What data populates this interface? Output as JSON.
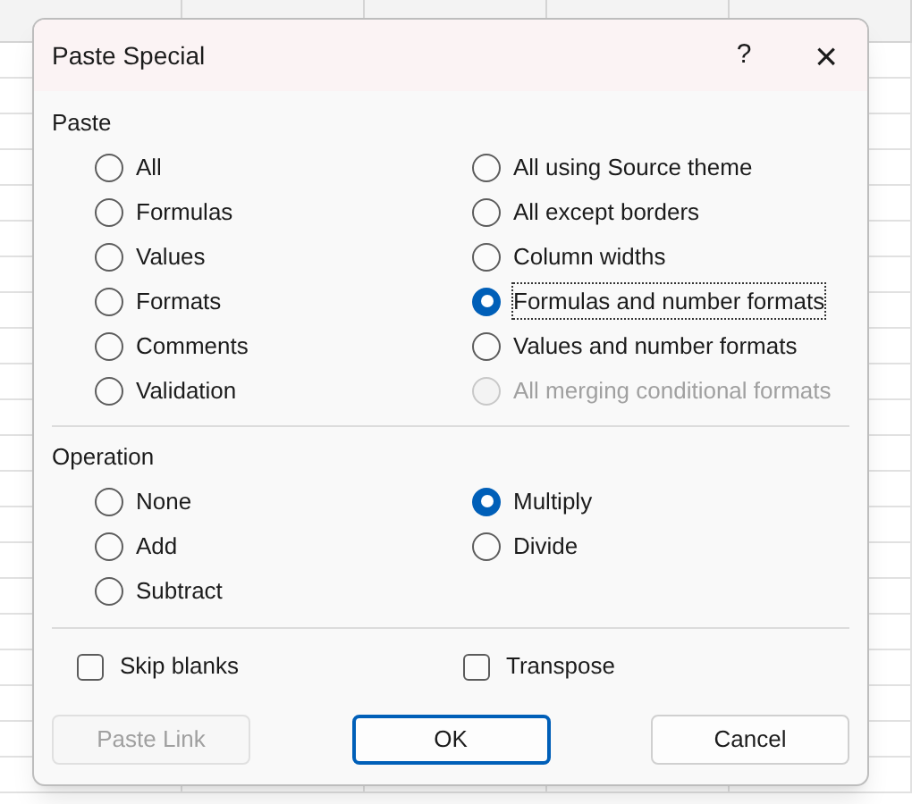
{
  "window": {
    "title": "Paste Special",
    "help_button": "?",
    "close_button": "×"
  },
  "paste": {
    "label": "Paste",
    "options": [
      {
        "label": "All",
        "selected": false,
        "disabled": false
      },
      {
        "label": "All using Source theme",
        "selected": false,
        "disabled": false
      },
      {
        "label": "Formulas",
        "selected": false,
        "disabled": false
      },
      {
        "label": "All except borders",
        "selected": false,
        "disabled": false
      },
      {
        "label": "Values",
        "selected": false,
        "disabled": false
      },
      {
        "label": "Column widths",
        "selected": false,
        "disabled": false
      },
      {
        "label": "Formats",
        "selected": false,
        "disabled": false
      },
      {
        "label": "Formulas and number formats",
        "selected": true,
        "disabled": false
      },
      {
        "label": "Comments",
        "selected": false,
        "disabled": false
      },
      {
        "label": "Values and number formats",
        "selected": false,
        "disabled": false
      },
      {
        "label": "Validation",
        "selected": false,
        "disabled": false
      },
      {
        "label": "All merging conditional formats",
        "selected": false,
        "disabled": true
      }
    ]
  },
  "operation": {
    "label": "Operation",
    "options": [
      {
        "label": "None",
        "selected": false
      },
      {
        "label": "Multiply",
        "selected": true
      },
      {
        "label": "Add",
        "selected": false
      },
      {
        "label": "Divide",
        "selected": false
      },
      {
        "label": "Subtract",
        "selected": false
      }
    ]
  },
  "checkboxes": [
    {
      "label": "Skip blanks",
      "checked": false
    },
    {
      "label": "Transpose",
      "checked": false
    }
  ],
  "buttons": [
    {
      "label": "Paste Link",
      "disabled": true,
      "default": false
    },
    {
      "label": "OK",
      "disabled": false,
      "default": true
    },
    {
      "label": "Cancel",
      "disabled": false,
      "default": false
    }
  ]
}
